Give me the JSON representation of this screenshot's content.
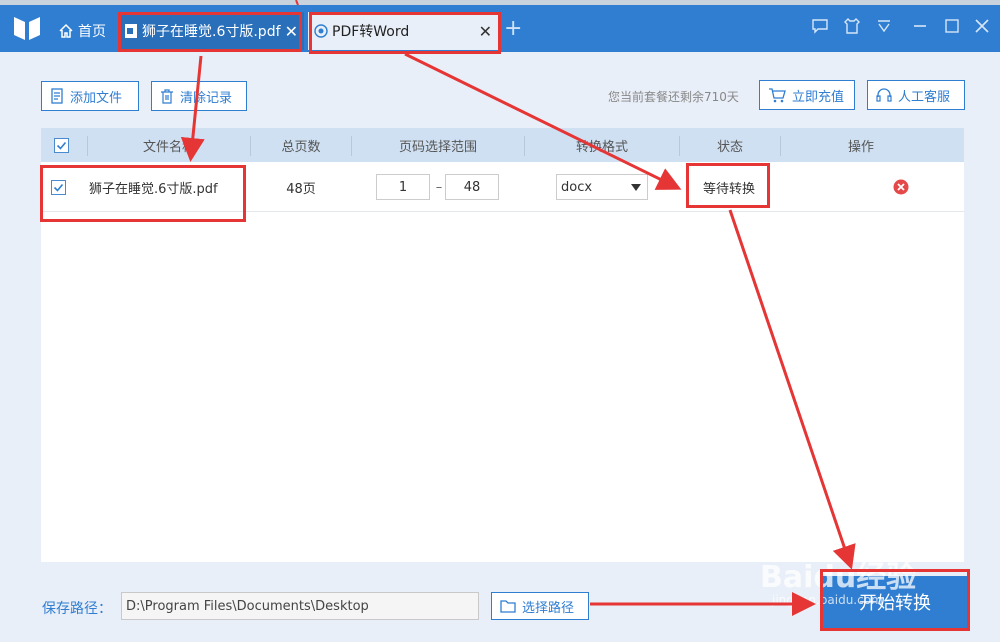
{
  "titlebar": {
    "home_tab": "首页",
    "file_tab": "狮子在睡觉.6寸版.pdf",
    "active_tab": "PDF转Word",
    "close_glyph": "✕",
    "plus_glyph": "+"
  },
  "toolbar": {
    "add_file": "添加文件",
    "clear_records": "清除记录",
    "remaining": "您当前套餐还剩余710天",
    "recharge": "立即充值",
    "support": "人工客服"
  },
  "table": {
    "headers": [
      "文件名称",
      "总页数",
      "页码选择范围",
      "转换格式",
      "状态",
      "操作"
    ],
    "rows": [
      {
        "filename": "狮子在睡觉.6寸版.pdf",
        "pages": "48页",
        "range_from": "1",
        "range_sep": "–",
        "range_to": "48",
        "format": "docx",
        "status": "等待转换"
      }
    ]
  },
  "footer": {
    "save_label": "保存路径：",
    "save_path": "D:\\Program Files\\Documents\\Desktop",
    "choose_path": "选择路径",
    "start": "开始转换"
  },
  "watermark": {
    "brand": "Baidu经验",
    "url": "jingyan.baidu.com"
  },
  "colors": {
    "accent": "#2f7ed1",
    "annotation": "#e53535",
    "header_bg": "#cfe0f3"
  }
}
